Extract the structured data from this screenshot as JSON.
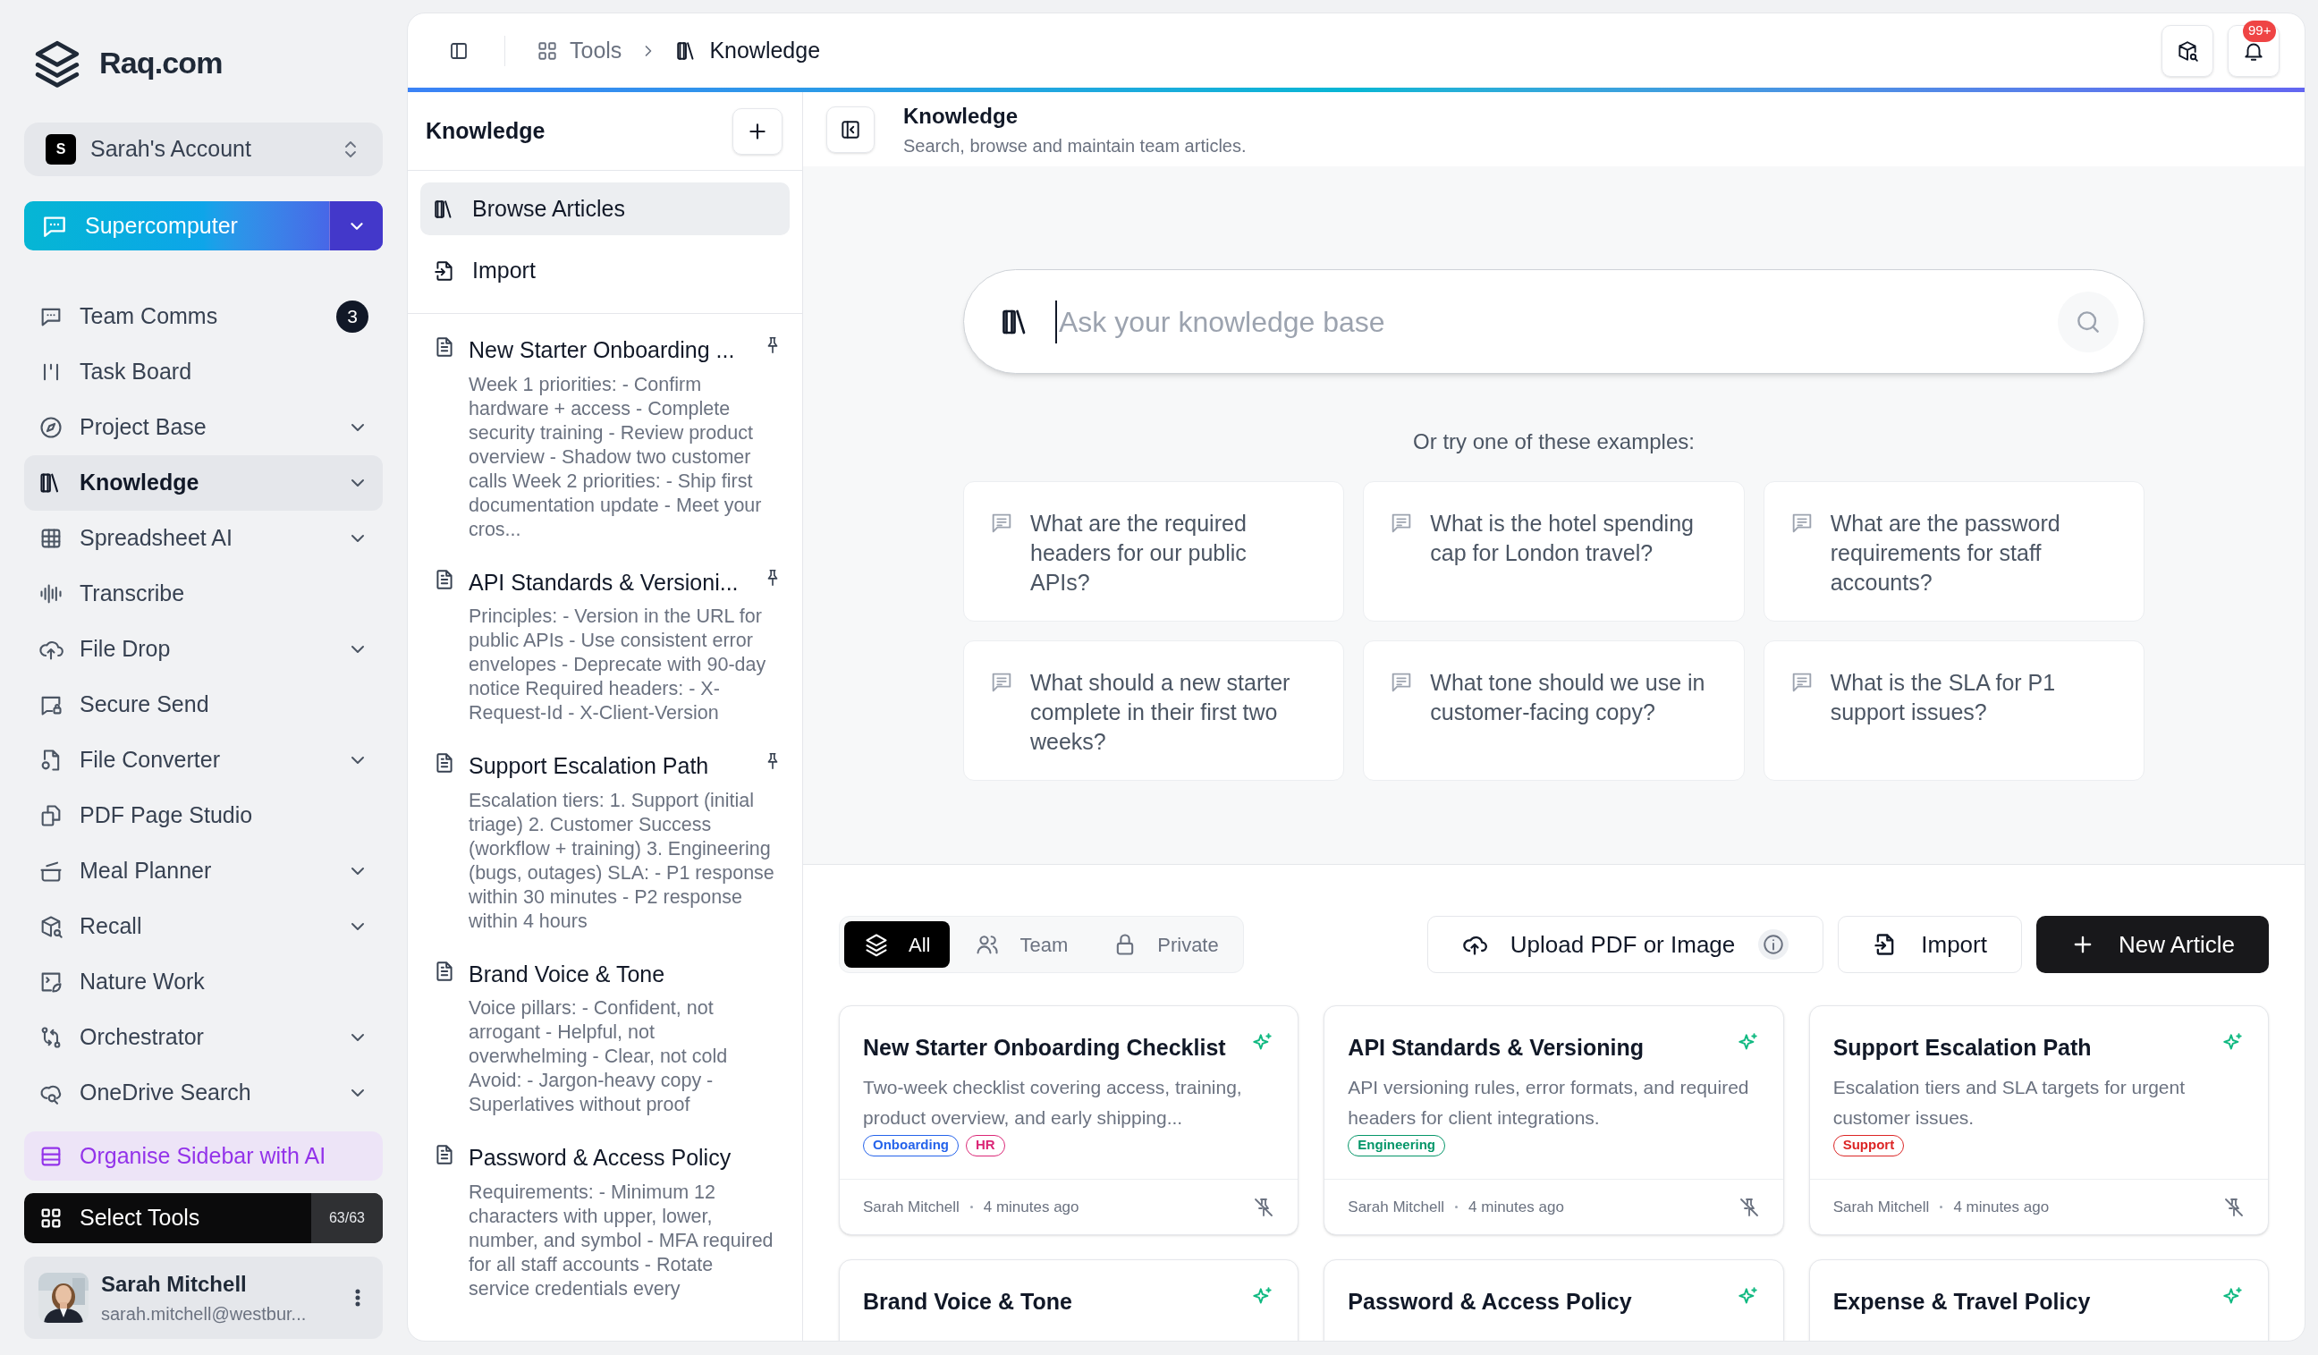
{
  "logo": {
    "text": "Raq.com"
  },
  "account": {
    "initial": "S",
    "name": "Sarah's Account"
  },
  "primary_tool": {
    "label": "Supercomputer"
  },
  "nav": [
    {
      "label": "Team Comms",
      "selected": false,
      "expandable": false,
      "badge": "3"
    },
    {
      "label": "Task Board",
      "selected": false,
      "expandable": false
    },
    {
      "label": "Project Base",
      "selected": false,
      "expandable": true
    },
    {
      "label": "Knowledge",
      "selected": true,
      "expandable": true
    },
    {
      "label": "Spreadsheet AI",
      "selected": false,
      "expandable": true
    },
    {
      "label": "Transcribe",
      "selected": false,
      "expandable": false
    },
    {
      "label": "File Drop",
      "selected": false,
      "expandable": true
    },
    {
      "label": "Secure Send",
      "selected": false,
      "expandable": false
    },
    {
      "label": "File Converter",
      "selected": false,
      "expandable": true
    },
    {
      "label": "PDF Page Studio",
      "selected": false,
      "expandable": false
    },
    {
      "label": "Meal Planner",
      "selected": false,
      "expandable": true
    },
    {
      "label": "Recall",
      "selected": false,
      "expandable": true
    },
    {
      "label": "Nature Work",
      "selected": false,
      "expandable": false
    },
    {
      "label": "Orchestrator",
      "selected": false,
      "expandable": true
    },
    {
      "label": "OneDrive Search",
      "selected": false,
      "expandable": true
    }
  ],
  "organise_button": {
    "label": "Organise Sidebar with AI"
  },
  "select_tools": {
    "label": "Select Tools",
    "count": "63/63"
  },
  "user": {
    "name": "Sarah Mitchell",
    "email": "sarah.mitchell@westbur..."
  },
  "breadcrumb": [
    {
      "label": "Tools"
    },
    {
      "label": "Knowledge"
    }
  ],
  "notifications": {
    "badge": "99+"
  },
  "knowledge_panel": {
    "title": "Knowledge",
    "menu": [
      {
        "label": "Browse Articles",
        "selected": true
      },
      {
        "label": "Import",
        "selected": false
      }
    ],
    "articles": [
      {
        "title": "New Starter Onboarding ...",
        "preview": "Week 1 priorities: - Confirm hardware + access - Complete security training - Review product overview - Shadow two customer calls Week 2 priorities: - Ship first documentation update - Meet your cros...",
        "pinned": true
      },
      {
        "title": "API Standards & Versioni...",
        "preview": "Principles: - Version in the URL for public APIs - Use consistent error envelopes - Deprecate with 90-day notice Required headers: - X-Request-Id - X-Client-Version",
        "pinned": true
      },
      {
        "title": "Support Escalation Path",
        "preview": "Escalation tiers: 1. Support (initial triage) 2. Customer Success (workflow + training) 3. Engineering (bugs, outages) SLA: - P1 response within 30 minutes - P2 response within 4 hours",
        "pinned": true
      },
      {
        "title": "Brand Voice & Tone",
        "preview": "Voice pillars: - Confident, not arrogant - Helpful, not overwhelming - Clear, not cold Avoid: - Jargon-heavy copy - Superlatives without proof",
        "pinned": false
      },
      {
        "title": "Password & Access Policy",
        "preview": "Requirements: - Minimum 12 characters with upper, lower, number, and symbol - MFA required for all staff accounts - Rotate service credentials every",
        "pinned": false
      }
    ]
  },
  "page_header": {
    "title": "Knowledge",
    "subtitle": "Search, browse and maintain team articles."
  },
  "search": {
    "placeholder": "Ask your knowledge base"
  },
  "examples_heading": "Or try one of these examples:",
  "examples": [
    "What are the required headers for our public APIs?",
    "What is the hotel spending cap for London travel?",
    "What are the password requirements for staff accounts?",
    "What should a new starter complete in their first two weeks?",
    "What tone should we use in customer-facing copy?",
    "What is the SLA for P1 support issues?"
  ],
  "filters": [
    {
      "label": "All",
      "selected": true
    },
    {
      "label": "Team",
      "selected": false
    },
    {
      "label": "Private",
      "selected": false
    }
  ],
  "actions": [
    {
      "label": "Upload PDF or Image",
      "kind": "upload"
    },
    {
      "label": "Import",
      "kind": "import"
    },
    {
      "label": "New Article",
      "kind": "new"
    }
  ],
  "cards": [
    {
      "title": "New Starter Onboarding Checklist",
      "description": "Two-week checklist covering access, training, product overview, and early shipping...",
      "tags": [
        {
          "label": "Onboarding",
          "color": "#2563eb"
        },
        {
          "label": "HR",
          "color": "#db2777"
        }
      ],
      "author": "Sarah Mitchell",
      "time": "4 minutes ago"
    },
    {
      "title": "API Standards & Versioning",
      "description": "API versioning rules, error formats, and required headers for client integrations.",
      "tags": [
        {
          "label": "Engineering",
          "color": "#059669"
        }
      ],
      "author": "Sarah Mitchell",
      "time": "4 minutes ago"
    },
    {
      "title": "Support Escalation Path",
      "description": "Escalation tiers and SLA targets for urgent customer issues.",
      "tags": [
        {
          "label": "Support",
          "color": "#dc2626"
        }
      ],
      "author": "Sarah Mitchell",
      "time": "4 minutes ago"
    },
    {
      "title": "Brand Voice & Tone"
    },
    {
      "title": "Password & Access Policy"
    },
    {
      "title": "Expense & Travel Policy"
    }
  ]
}
